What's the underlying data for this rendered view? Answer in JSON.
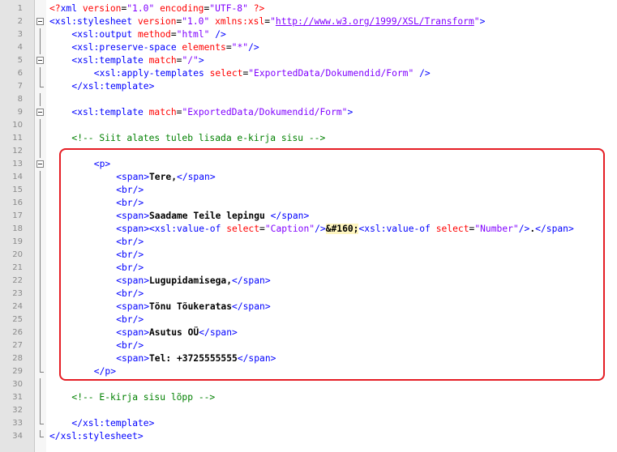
{
  "editor": {
    "lines": [
      {
        "n": "1",
        "indent": 0,
        "fold": "none",
        "tokens": [
          {
            "t": "pi",
            "v": "<?"
          },
          {
            "t": "tag",
            "v": "xml "
          },
          {
            "t": "attr",
            "v": "version"
          },
          {
            "t": "eq",
            "v": "="
          },
          {
            "t": "val",
            "v": "\"1.0\""
          },
          {
            "t": "attr",
            "v": " encoding"
          },
          {
            "t": "eq",
            "v": "="
          },
          {
            "t": "val",
            "v": "\"UTF-8\""
          },
          {
            "t": "pi",
            "v": " ?>"
          }
        ]
      },
      {
        "n": "2",
        "indent": 0,
        "fold": "box",
        "tokens": [
          {
            "t": "tag",
            "v": "<xsl:stylesheet "
          },
          {
            "t": "attr",
            "v": "version"
          },
          {
            "t": "eq",
            "v": "="
          },
          {
            "t": "val",
            "v": "\"1.0\""
          },
          {
            "t": "attr",
            "v": " xmlns:xsl"
          },
          {
            "t": "eq",
            "v": "="
          },
          {
            "t": "val",
            "v": "\""
          },
          {
            "t": "url",
            "v": "http://www.w3.org/1999/XSL/Transform"
          },
          {
            "t": "val",
            "v": "\""
          },
          {
            "t": "tag",
            "v": ">"
          }
        ]
      },
      {
        "n": "3",
        "indent": 4,
        "fold": "line",
        "tokens": [
          {
            "t": "tag",
            "v": "<xsl:output "
          },
          {
            "t": "attr",
            "v": "method"
          },
          {
            "t": "eq",
            "v": "="
          },
          {
            "t": "val",
            "v": "\"html\""
          },
          {
            "t": "tag",
            "v": " />"
          }
        ]
      },
      {
        "n": "4",
        "indent": 4,
        "fold": "line",
        "tokens": [
          {
            "t": "tag",
            "v": "<xsl:preserve-space "
          },
          {
            "t": "attr",
            "v": "elements"
          },
          {
            "t": "eq",
            "v": "="
          },
          {
            "t": "val",
            "v": "\"*\""
          },
          {
            "t": "tag",
            "v": "/>"
          }
        ]
      },
      {
        "n": "5",
        "indent": 4,
        "fold": "box",
        "tokens": [
          {
            "t": "tag",
            "v": "<xsl:template "
          },
          {
            "t": "attr",
            "v": "match"
          },
          {
            "t": "eq",
            "v": "="
          },
          {
            "t": "val",
            "v": "\"/\""
          },
          {
            "t": "tag",
            "v": ">"
          }
        ]
      },
      {
        "n": "6",
        "indent": 8,
        "fold": "line",
        "tokens": [
          {
            "t": "tag",
            "v": "<xsl:apply-templates "
          },
          {
            "t": "attr",
            "v": "select"
          },
          {
            "t": "eq",
            "v": "="
          },
          {
            "t": "val",
            "v": "\"ExportedData/Dokumendid/Form\""
          },
          {
            "t": "tag",
            "v": " />"
          }
        ]
      },
      {
        "n": "7",
        "indent": 4,
        "fold": "end",
        "tokens": [
          {
            "t": "tag",
            "v": "</xsl:template>"
          }
        ]
      },
      {
        "n": "8",
        "indent": 0,
        "fold": "line",
        "tokens": []
      },
      {
        "n": "9",
        "indent": 4,
        "fold": "box",
        "tokens": [
          {
            "t": "tag",
            "v": "<xsl:template "
          },
          {
            "t": "attr",
            "v": "match"
          },
          {
            "t": "eq",
            "v": "="
          },
          {
            "t": "val",
            "v": "\"ExportedData/Dokumendid/Form\""
          },
          {
            "t": "tag",
            "v": ">"
          }
        ]
      },
      {
        "n": "10",
        "indent": 0,
        "fold": "line",
        "tokens": []
      },
      {
        "n": "11",
        "indent": 4,
        "fold": "line",
        "tokens": [
          {
            "t": "comment",
            "v": "<!-- Siit alates tuleb lisada e-kirja sisu -->"
          }
        ]
      },
      {
        "n": "12",
        "indent": 0,
        "fold": "line",
        "tokens": []
      },
      {
        "n": "13",
        "indent": 8,
        "fold": "box",
        "tokens": [
          {
            "t": "tag",
            "v": "<p>"
          }
        ]
      },
      {
        "n": "14",
        "indent": 12,
        "fold": "line",
        "tokens": [
          {
            "t": "tag",
            "v": "<span>"
          },
          {
            "t": "text",
            "v": "Tere,"
          },
          {
            "t": "tag",
            "v": "</span>"
          }
        ]
      },
      {
        "n": "15",
        "indent": 12,
        "fold": "line",
        "tokens": [
          {
            "t": "tag",
            "v": "<br/>"
          }
        ]
      },
      {
        "n": "16",
        "indent": 12,
        "fold": "line",
        "tokens": [
          {
            "t": "tag",
            "v": "<br/>"
          }
        ]
      },
      {
        "n": "17",
        "indent": 12,
        "fold": "line",
        "tokens": [
          {
            "t": "tag",
            "v": "<span>"
          },
          {
            "t": "text",
            "v": "Saadame Teile lepingu "
          },
          {
            "t": "tag",
            "v": "</span>"
          }
        ]
      },
      {
        "n": "18",
        "indent": 12,
        "fold": "line",
        "tokens": [
          {
            "t": "tag",
            "v": "<span><xsl:value-of "
          },
          {
            "t": "attr",
            "v": "select"
          },
          {
            "t": "eq",
            "v": "="
          },
          {
            "t": "val",
            "v": "\"Caption\""
          },
          {
            "t": "tag",
            "v": "/>"
          },
          {
            "t": "ent",
            "v": "&#160;"
          },
          {
            "t": "tag",
            "v": "<xsl:value-of "
          },
          {
            "t": "attr",
            "v": "select"
          },
          {
            "t": "eq",
            "v": "="
          },
          {
            "t": "val",
            "v": "\"Number\""
          },
          {
            "t": "tag",
            "v": "/>"
          },
          {
            "t": "text",
            "v": "."
          },
          {
            "t": "tag",
            "v": "</span>"
          }
        ]
      },
      {
        "n": "19",
        "indent": 12,
        "fold": "line",
        "tokens": [
          {
            "t": "tag",
            "v": "<br/>"
          }
        ]
      },
      {
        "n": "20",
        "indent": 12,
        "fold": "line",
        "tokens": [
          {
            "t": "tag",
            "v": "<br/>"
          }
        ]
      },
      {
        "n": "21",
        "indent": 12,
        "fold": "line",
        "tokens": [
          {
            "t": "tag",
            "v": "<br/>"
          }
        ]
      },
      {
        "n": "22",
        "indent": 12,
        "fold": "line",
        "tokens": [
          {
            "t": "tag",
            "v": "<span>"
          },
          {
            "t": "text",
            "v": "Lugupidamisega,"
          },
          {
            "t": "tag",
            "v": "</span>"
          }
        ]
      },
      {
        "n": "23",
        "indent": 12,
        "fold": "line",
        "tokens": [
          {
            "t": "tag",
            "v": "<br/>"
          }
        ]
      },
      {
        "n": "24",
        "indent": 12,
        "fold": "line",
        "tokens": [
          {
            "t": "tag",
            "v": "<span>"
          },
          {
            "t": "text",
            "v": "Tõnu Tõukeratas"
          },
          {
            "t": "tag",
            "v": "</span>"
          }
        ]
      },
      {
        "n": "25",
        "indent": 12,
        "fold": "line",
        "tokens": [
          {
            "t": "tag",
            "v": "<br/>"
          }
        ]
      },
      {
        "n": "26",
        "indent": 12,
        "fold": "line",
        "tokens": [
          {
            "t": "tag",
            "v": "<span>"
          },
          {
            "t": "text",
            "v": "Asutus OÜ"
          },
          {
            "t": "tag",
            "v": "</span>"
          }
        ]
      },
      {
        "n": "27",
        "indent": 12,
        "fold": "line",
        "tokens": [
          {
            "t": "tag",
            "v": "<br/>"
          }
        ]
      },
      {
        "n": "28",
        "indent": 12,
        "fold": "line",
        "tokens": [
          {
            "t": "tag",
            "v": "<span>"
          },
          {
            "t": "text",
            "v": "Tel: +3725555555"
          },
          {
            "t": "tag",
            "v": "</span>"
          }
        ]
      },
      {
        "n": "29",
        "indent": 8,
        "fold": "end",
        "tokens": [
          {
            "t": "tag",
            "v": "</p>"
          }
        ]
      },
      {
        "n": "30",
        "indent": 0,
        "fold": "line",
        "tokens": []
      },
      {
        "n": "31",
        "indent": 4,
        "fold": "line",
        "tokens": [
          {
            "t": "comment",
            "v": "<!-- E-kirja sisu lõpp -->"
          }
        ]
      },
      {
        "n": "32",
        "indent": 0,
        "fold": "line",
        "tokens": []
      },
      {
        "n": "33",
        "indent": 4,
        "fold": "end",
        "tokens": [
          {
            "t": "tag",
            "v": "</xsl:template>"
          }
        ]
      },
      {
        "n": "34",
        "indent": 0,
        "fold": "end",
        "tokens": [
          {
            "t": "tag",
            "v": "</xsl:stylesheet>"
          }
        ]
      }
    ]
  },
  "colors": {
    "highlight_border": "#e51e25",
    "tag": "#0000ff",
    "attribute": "#ff0000",
    "value": "#8000ff",
    "comment": "#008000",
    "gutter": "#e4e4e4"
  }
}
